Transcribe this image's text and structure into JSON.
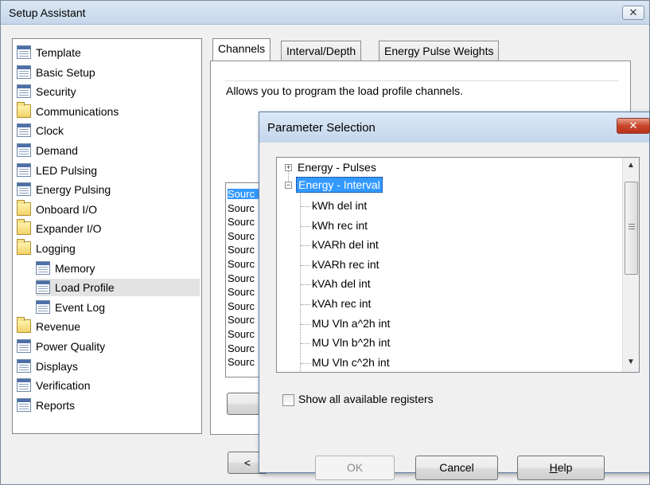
{
  "setup_window": {
    "title": "Setup Assistant",
    "close_glyph": "✕"
  },
  "nav_tree": {
    "items": [
      {
        "label": "Template",
        "icon": "document-icon"
      },
      {
        "label": "Basic Setup",
        "icon": "document-icon"
      },
      {
        "label": "Security",
        "icon": "document-icon"
      },
      {
        "label": "Communications",
        "icon": "folder-icon"
      },
      {
        "label": "Clock",
        "icon": "document-icon"
      },
      {
        "label": "Demand",
        "icon": "document-icon"
      },
      {
        "label": "LED Pulsing",
        "icon": "document-icon"
      },
      {
        "label": "Energy Pulsing",
        "icon": "document-icon"
      },
      {
        "label": "Onboard I/O",
        "icon": "folder-icon"
      },
      {
        "label": "Expander I/O",
        "icon": "folder-icon"
      },
      {
        "label": "Logging",
        "icon": "folder-icon"
      },
      {
        "label": "Memory",
        "icon": "document-icon"
      },
      {
        "label": "Load Profile",
        "icon": "document-icon"
      },
      {
        "label": "Event Log",
        "icon": "document-icon"
      },
      {
        "label": "Revenue",
        "icon": "folder-icon"
      },
      {
        "label": "Power Quality",
        "icon": "document-icon"
      },
      {
        "label": "Displays",
        "icon": "document-icon"
      },
      {
        "label": "Verification",
        "icon": "document-icon"
      },
      {
        "label": "Reports",
        "icon": "document-icon"
      }
    ],
    "selected": "Load Profile"
  },
  "tabs": [
    {
      "label": "Channels",
      "active": true
    },
    {
      "label": "Interval/Depth",
      "active": false
    },
    {
      "label": "Energy Pulse Weights",
      "active": false
    }
  ],
  "channels_tab": {
    "description": "Allows you to program the load profile channels.",
    "source_rows": [
      "Sourc",
      "Sourc",
      "Sourc",
      "Sourc",
      "Sourc",
      "Sourc",
      "Sourc",
      "Sourc",
      "Sourc",
      "Sourc",
      "Sourc",
      "Sourc",
      "Sourc"
    ],
    "back_button_label": "<"
  },
  "parameter_dialog": {
    "title": "Parameter Selection",
    "close_glyph": "✕",
    "tree": {
      "groups": [
        {
          "label": "Energy - Pulses",
          "expanded": false,
          "expander": "+"
        },
        {
          "label": "Energy - Interval",
          "expanded": true,
          "expander": "−",
          "selected": true
        }
      ],
      "children": [
        "kWh del int",
        "kWh rec int",
        "kVARh del int",
        "kVARh rec int",
        "kVAh del int",
        "kVAh rec int",
        "MU Vln a^2h int",
        "MU Vln b^2h int",
        "MU Vln c^2h int"
      ]
    },
    "scroll": {
      "up_glyph": "▲",
      "down_glyph": "▼"
    },
    "checkbox": {
      "label": "Show all available registers",
      "checked": false
    },
    "buttons": {
      "ok": "OK",
      "cancel": "Cancel",
      "help_mnemonic": "H",
      "help_rest": "elp"
    }
  }
}
